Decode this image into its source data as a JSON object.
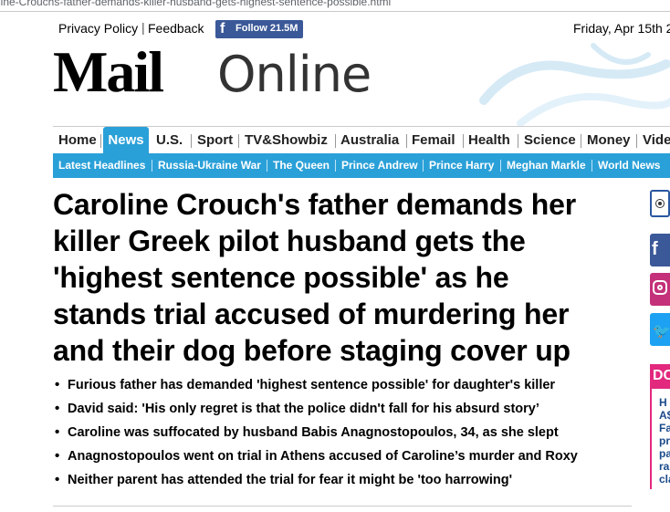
{
  "browser": {
    "url_fragment": "line-Crouchs-father-demands-killer-husband-gets-highest-sentence-possible.html"
  },
  "top_links": {
    "privacy": "Privacy Policy",
    "feedback": "Feedback",
    "facebook_follow": "Follow 21.5M",
    "date": "Friday, Apr 15th 2"
  },
  "logo": {
    "mail": "Mail",
    "online": "Online"
  },
  "nav": {
    "items": [
      "Home",
      "News",
      "U.S.",
      "Sport",
      "TV&Showbiz",
      "Australia",
      "Femail",
      "Health",
      "Science",
      "Money",
      "Vide"
    ],
    "active": "News"
  },
  "subnav": {
    "items": [
      "Latest Headlines",
      "Russia-Ukraine War",
      "The Queen",
      "Prince Andrew",
      "Prince Harry",
      "Meghan Markle",
      "World News"
    ]
  },
  "article": {
    "headline_lines": [
      "Caroline Crouch's father demands her",
      "killer Greek pilot husband gets the",
      "'highest sentence possible' as he",
      "stands trial accused of murdering her",
      "and their dog before staging cover up"
    ],
    "bullets": [
      "Furious father has demanded 'highest sentence possible' for daughter's killer",
      "David said: 'His only regret is that the police didn't fall for his absurd story’",
      "Caroline was suffocated by husband Babis Anagnostopoulos, 34, as she slept",
      "Anagnostopoulos went on trial in Athens accused of Caroline’s murder and Roxy",
      "Neither parent has attended the trial for fear it might be 'too harrowing'"
    ]
  },
  "sidebar": {
    "pink_header": "DC",
    "teaser_lines": [
      "H",
      "A$",
      "Fa",
      "pr",
      "pa",
      "ra",
      "cla"
    ]
  },
  "colors": {
    "accent_blue": "#2aa0d8",
    "facebook": "#3b5998",
    "instagram": "#c4307a",
    "twitter": "#1da1f2",
    "pink": "#e2297e"
  }
}
